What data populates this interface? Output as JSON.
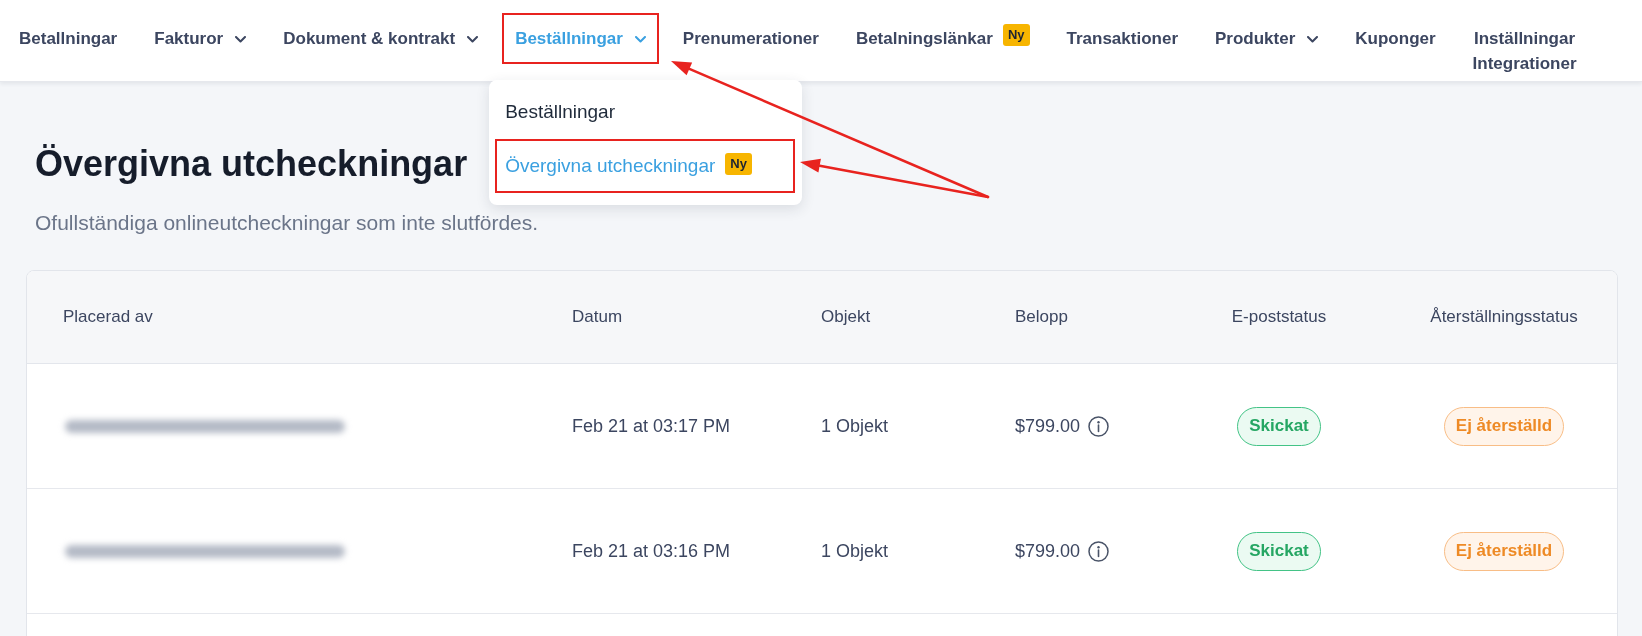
{
  "nav": {
    "items": [
      {
        "label": "Betallningar",
        "selected": false,
        "has_menu": false,
        "highlighted": false
      },
      {
        "label": "Fakturor",
        "selected": false,
        "has_menu": true,
        "highlighted": false
      },
      {
        "label": "Dokument & kontrakt",
        "selected": false,
        "has_menu": true,
        "highlighted": false
      },
      {
        "label": "Beställningar",
        "selected": true,
        "has_menu": true,
        "highlighted": true,
        "menu": {
          "items": [
            {
              "label": "Beställningar",
              "selected": false,
              "highlighted": false
            },
            {
              "label": "Övergivna utcheckningar",
              "selected": true,
              "highlighted": true,
              "badge": "Ny"
            }
          ]
        }
      },
      {
        "label": "Prenumerationer",
        "selected": false,
        "has_menu": false,
        "highlighted": false
      },
      {
        "label": "Betalningslänkar",
        "selected": false,
        "has_menu": false,
        "highlighted": false,
        "badge": "Ny"
      },
      {
        "label": "Transaktioner",
        "selected": false,
        "has_menu": false,
        "highlighted": false
      },
      {
        "label": "Produkter",
        "selected": false,
        "has_menu": true,
        "highlighted": false
      },
      {
        "label": "Kuponger",
        "selected": false,
        "has_menu": false,
        "highlighted": false
      },
      {
        "label": "Inställningar",
        "selected": false,
        "has_menu": false,
        "highlighted": false,
        "sublabel": "Integrationer"
      }
    ]
  },
  "annotation": {
    "kind": "arrows"
  },
  "page": {
    "title": "Övergivna utcheckningar",
    "subtitle": "Ofullständiga onlineutcheckningar som inte slutfördes."
  },
  "table": {
    "columns": [
      "Placerad av",
      "Datum",
      "Objekt",
      "Belopp",
      "E-poststatus",
      "Återställningsstatus"
    ],
    "rows": [
      {
        "placed_by_redacted": true,
        "date": "Feb 21 at 03:17 PM",
        "items": "1 Objekt",
        "amount": "$799.00",
        "email_status": {
          "label": "Skickat",
          "kind": "sent"
        },
        "recovery_status": {
          "label": "Ej återställd",
          "kind": "not_recovered"
        }
      },
      {
        "placed_by_redacted": true,
        "date": "Feb 21 at 03:16 PM",
        "items": "1 Objekt",
        "amount": "$799.00",
        "email_status": {
          "label": "Skickat",
          "kind": "sent"
        },
        "recovery_status": {
          "label": "Ej återställd",
          "kind": "not_recovered"
        }
      }
    ]
  }
}
